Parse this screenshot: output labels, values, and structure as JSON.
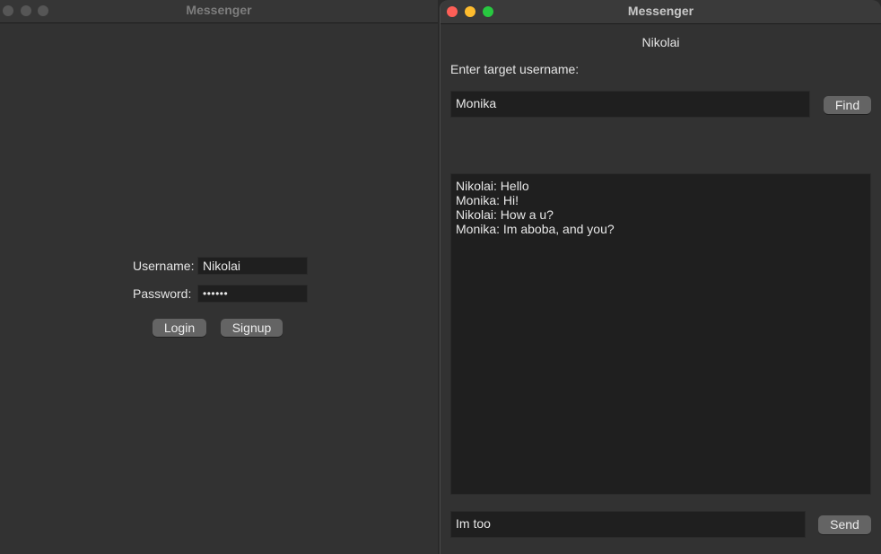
{
  "login_window": {
    "title": "Messenger",
    "username_label": "Username:",
    "username_value": "Nikolai",
    "password_label": "Password:",
    "password_value": "••••••",
    "login_button": "Login",
    "signup_button": "Signup"
  },
  "chat_window": {
    "title": "Messenger",
    "current_user": "Nikolai",
    "target_label": "Enter target username:",
    "target_value": "Monika",
    "find_button": "Find",
    "messages": [
      "Nikolai: Hello",
      "Monika: Hi!",
      "Nikolai: How a u?",
      "Monika: Im aboba, and you?"
    ],
    "message_input": "Im too",
    "send_button": "Send"
  },
  "colors": {
    "close": "#fe5f57",
    "minimize": "#febc2e",
    "maximize": "#28c840",
    "inactive_light": "#565656",
    "window_bg": "#323232",
    "field_bg": "#1f1f1f",
    "button_bg": "#646464"
  }
}
